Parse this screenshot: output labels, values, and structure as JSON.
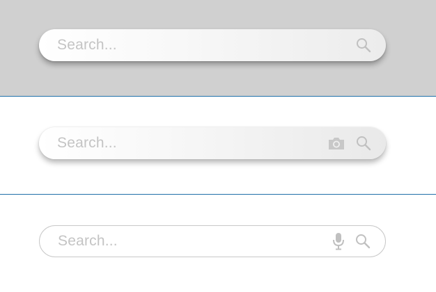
{
  "search_bars": [
    {
      "placeholder": "Search...",
      "icons": [
        "search-icon"
      ]
    },
    {
      "placeholder": "Search...",
      "icons": [
        "camera-icon",
        "search-icon"
      ]
    },
    {
      "placeholder": "Search...",
      "icons": [
        "microphone-icon",
        "search-icon"
      ]
    }
  ],
  "colors": {
    "top_panel_background": "#d0d0d0",
    "divider": "#1f6fa8",
    "placeholder_text": "#c4c4c4",
    "icon": "#c0c0c0",
    "outline_border": "#c8c8c8"
  }
}
